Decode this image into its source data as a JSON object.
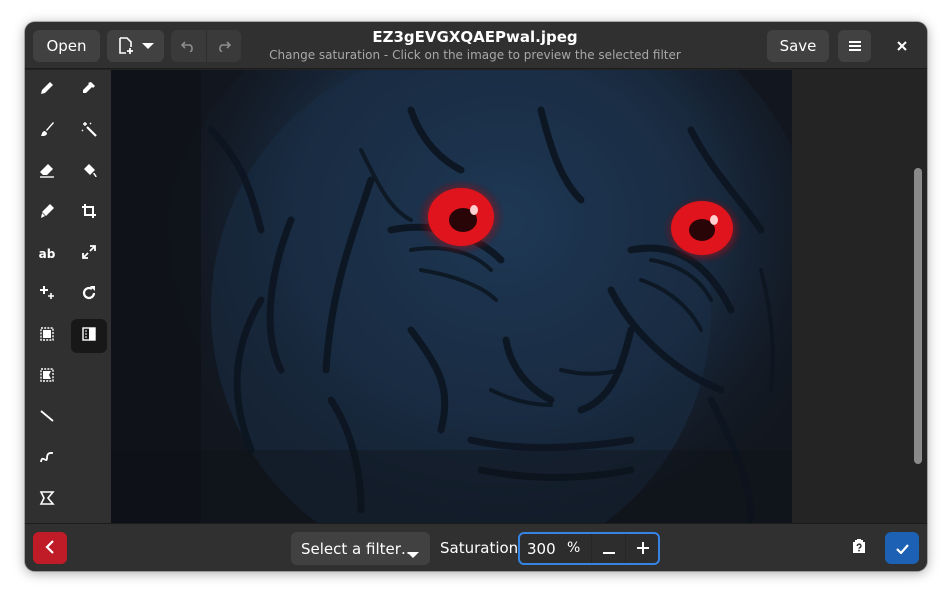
{
  "header": {
    "open_label": "Open",
    "title": "EZ3gEVGXQAEPwal.jpeg",
    "subtitle": "Change saturation - Click on the image to preview the selected filter",
    "save_label": "Save"
  },
  "tools": [
    {
      "name": "pencil-icon"
    },
    {
      "name": "color-picker-icon"
    },
    {
      "name": "brush-icon"
    },
    {
      "name": "magic-wand-icon"
    },
    {
      "name": "eraser-icon"
    },
    {
      "name": "paint-bucket-icon"
    },
    {
      "name": "highlighter-icon"
    },
    {
      "name": "crop-icon"
    },
    {
      "name": "text-icon"
    },
    {
      "name": "scale-icon"
    },
    {
      "name": "plus-sparkle-icon"
    },
    {
      "name": "rotate-icon"
    },
    {
      "name": "rect-select-icon"
    },
    {
      "name": "filters-icon"
    },
    {
      "name": "free-select-icon"
    },
    {
      "name": "line-icon"
    },
    {
      "name": "curve-icon"
    },
    {
      "name": "shape-icon"
    }
  ],
  "text_tool_glyph": "ab",
  "bottom": {
    "filter_placeholder": "Select a filter…",
    "saturation_label": "Saturation",
    "saturation_value": "300",
    "saturation_unit": "%"
  },
  "colors": {
    "accent": "#3584e4",
    "destructive": "#c01c28",
    "apply": "#1c61b4",
    "eye_red": "#e0141c"
  }
}
